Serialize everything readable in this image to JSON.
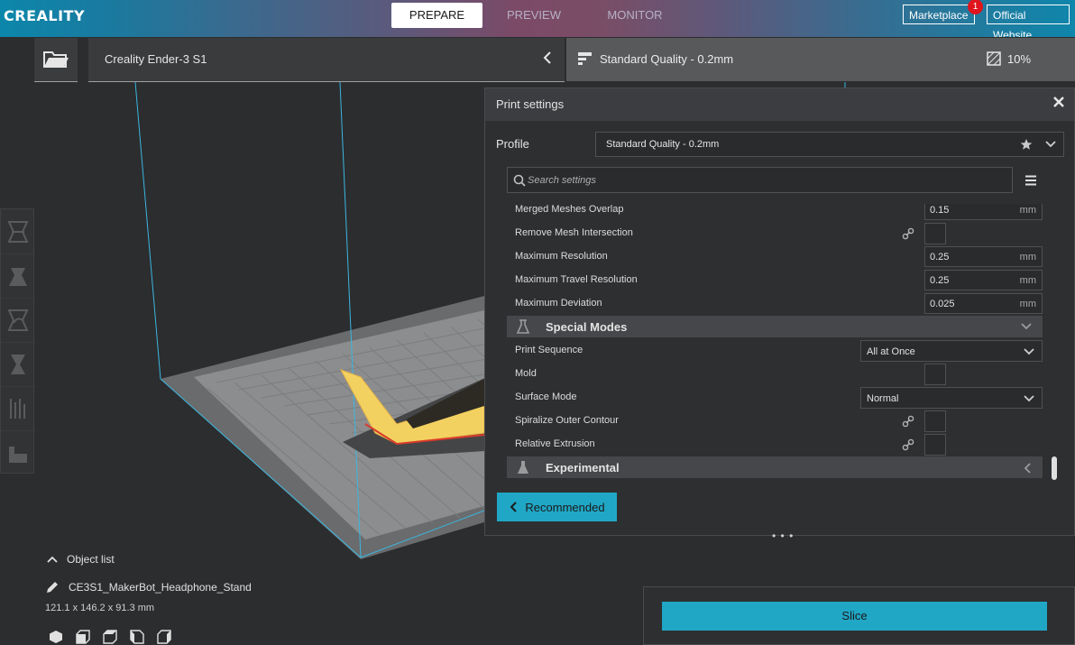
{
  "app": {
    "logo": "CREALITY"
  },
  "stages": {
    "prepare": "PREPARE",
    "preview": "PREVIEW",
    "monitor": "MONITOR"
  },
  "top_buttons": {
    "marketplace": "Marketplace",
    "marketplace_badge": "1",
    "official_website": "Official Website"
  },
  "machine": {
    "name": "Creality Ender-3 S1"
  },
  "quality_bar": {
    "profile": "Standard Quality - 0.2mm",
    "infill": "10%"
  },
  "print_settings": {
    "title": "Print settings",
    "profile_label": "Profile",
    "profile_value": "Standard Quality - 0.2mm",
    "search_placeholder": "Search settings",
    "rows": {
      "merged_meshes_overlap": {
        "label": "Merged Meshes Overlap",
        "value": "0.15",
        "unit": "mm"
      },
      "remove_mesh_intersection": {
        "label": "Remove Mesh Intersection"
      },
      "maximum_resolution": {
        "label": "Maximum Resolution",
        "value": "0.25",
        "unit": "mm"
      },
      "maximum_travel_resolution": {
        "label": "Maximum Travel Resolution",
        "value": "0.25",
        "unit": "mm"
      },
      "maximum_deviation": {
        "label": "Maximum Deviation",
        "value": "0.025",
        "unit": "mm"
      },
      "special_modes": {
        "label": "Special Modes"
      },
      "print_sequence": {
        "label": "Print Sequence",
        "value": "All at Once"
      },
      "mold": {
        "label": "Mold"
      },
      "surface_mode": {
        "label": "Surface Mode",
        "value": "Normal"
      },
      "spiralize_outer_contour": {
        "label": "Spiralize Outer Contour"
      },
      "relative_extrusion": {
        "label": "Relative Extrusion"
      },
      "experimental": {
        "label": "Experimental"
      }
    },
    "recommended_button": "Recommended",
    "resize_handle": "• • •"
  },
  "object_list": {
    "title": "Object list",
    "object_name": "CE3S1_MakerBot_Headphone_Stand",
    "dimensions": "121.1 x 146.2 x 91.3 mm"
  },
  "slice": {
    "label": "Slice"
  },
  "colors": {
    "accent": "#20a7c6",
    "badge": "#e0141c",
    "bed_edge": "#3bb6e0",
    "model": "#f3d160"
  }
}
